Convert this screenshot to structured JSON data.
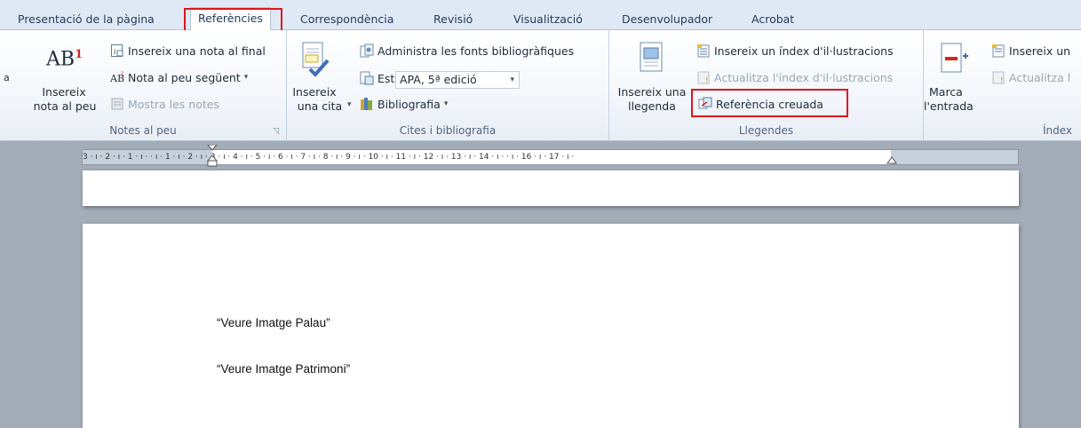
{
  "tabs": [
    {
      "label": "Presentació de la pàgina"
    },
    {
      "label": "Referències"
    },
    {
      "label": "Correspondència"
    },
    {
      "label": "Revisió"
    },
    {
      "label": "Visualització"
    },
    {
      "label": "Desenvolupador"
    },
    {
      "label": "Acrobat"
    }
  ],
  "footnotes": {
    "big_icon_text": "AB",
    "big_icon_sup": "1",
    "insert_label_1": "Insereix",
    "insert_label_2": "nota al peu",
    "insert_endnote": "Insereix una nota al final",
    "next_footnote": "Nota al peu següent",
    "show_notes": "Mostra les notes",
    "group_label": "Notes al peu",
    "cut_glyph": "a"
  },
  "citations": {
    "insert_citation_1": "Insereix",
    "insert_citation_2": "una cita",
    "manage_sources": "Administra les fonts bibliogràfiques",
    "style_label": "Estil:",
    "style_value": "APA, 5ª edició",
    "bibliography": "Bibliografia",
    "group_label": "Cites i bibliografia"
  },
  "captions": {
    "insert_caption_1": "Insereix una",
    "insert_caption_2": "llegenda",
    "insert_table_figures": "Insereix un índex d'il·lustracions",
    "update_table": "Actualitza l'índex d'il·lustracions",
    "cross_reference": "Referència creuada",
    "group_label": "Llegendes"
  },
  "index": {
    "mark_entry_1": "Marca",
    "mark_entry_2": "l'entrada",
    "insert_index": "Insereix un",
    "update_index": "Actualitza l",
    "group_label": "Índex"
  },
  "ruler": {
    "numbers": "3 · ı · 2 · ı · 1 · ı ·   · ı · 1 · ı · 2 · ı · 3 · ı · 4 · ı · 5 · ı · 6 · ı · 7 · ı · 8 · ı · 9 · ı · 10 · ı · 11 · ı · 12 · ı · 13 · ı · 14 · ı ·   · ı · 16 · ı · 17 · ı ·"
  },
  "document": {
    "line1": "“Veure Imatge Palau”",
    "line2": "“Veure Imatge Patrimoni”"
  },
  "colors": {
    "highlight": "#e0141e",
    "ribbon_bg": "#dfe9f5",
    "workspace": "#a3acb7"
  }
}
